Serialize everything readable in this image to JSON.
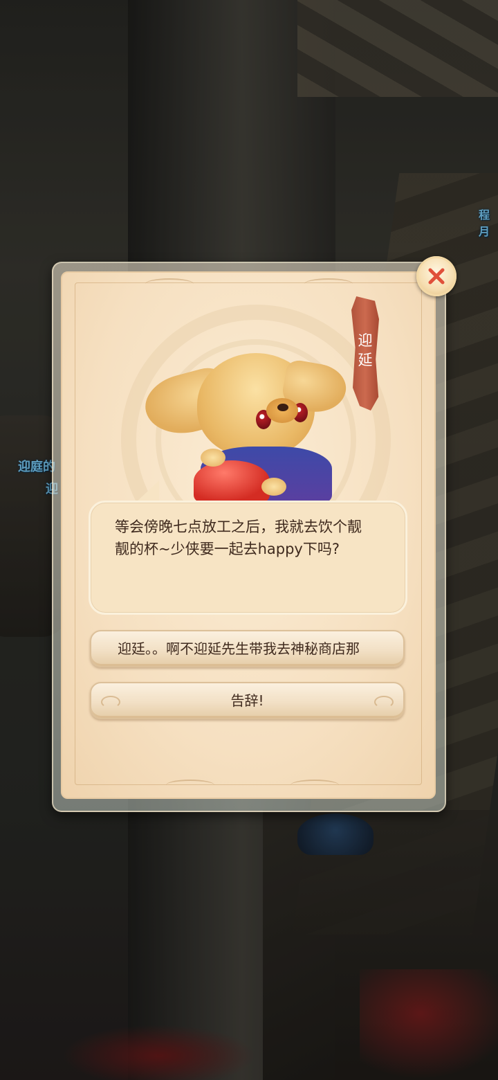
{
  "background": {
    "side_labels": [
      {
        "text": "迎庭的"
      },
      {
        "text": "迎"
      },
      {
        "text": "程月"
      }
    ]
  },
  "dialog": {
    "npc_name": "迎\n延",
    "speech": "等会傍晚七点放工之后，我就去饮个靓\n靓的杯~少侠要一起去happy下吗?",
    "options": [
      {
        "label": "迎廷。。啊不迎延先生带我去神秘商店那"
      },
      {
        "label": "告辞!"
      }
    ],
    "close_icon": "close-icon",
    "colors": {
      "panel": "#f6e0c1",
      "banner": "#c05f44",
      "close_x": "#e0503a",
      "text": "#3f2a1e"
    }
  }
}
